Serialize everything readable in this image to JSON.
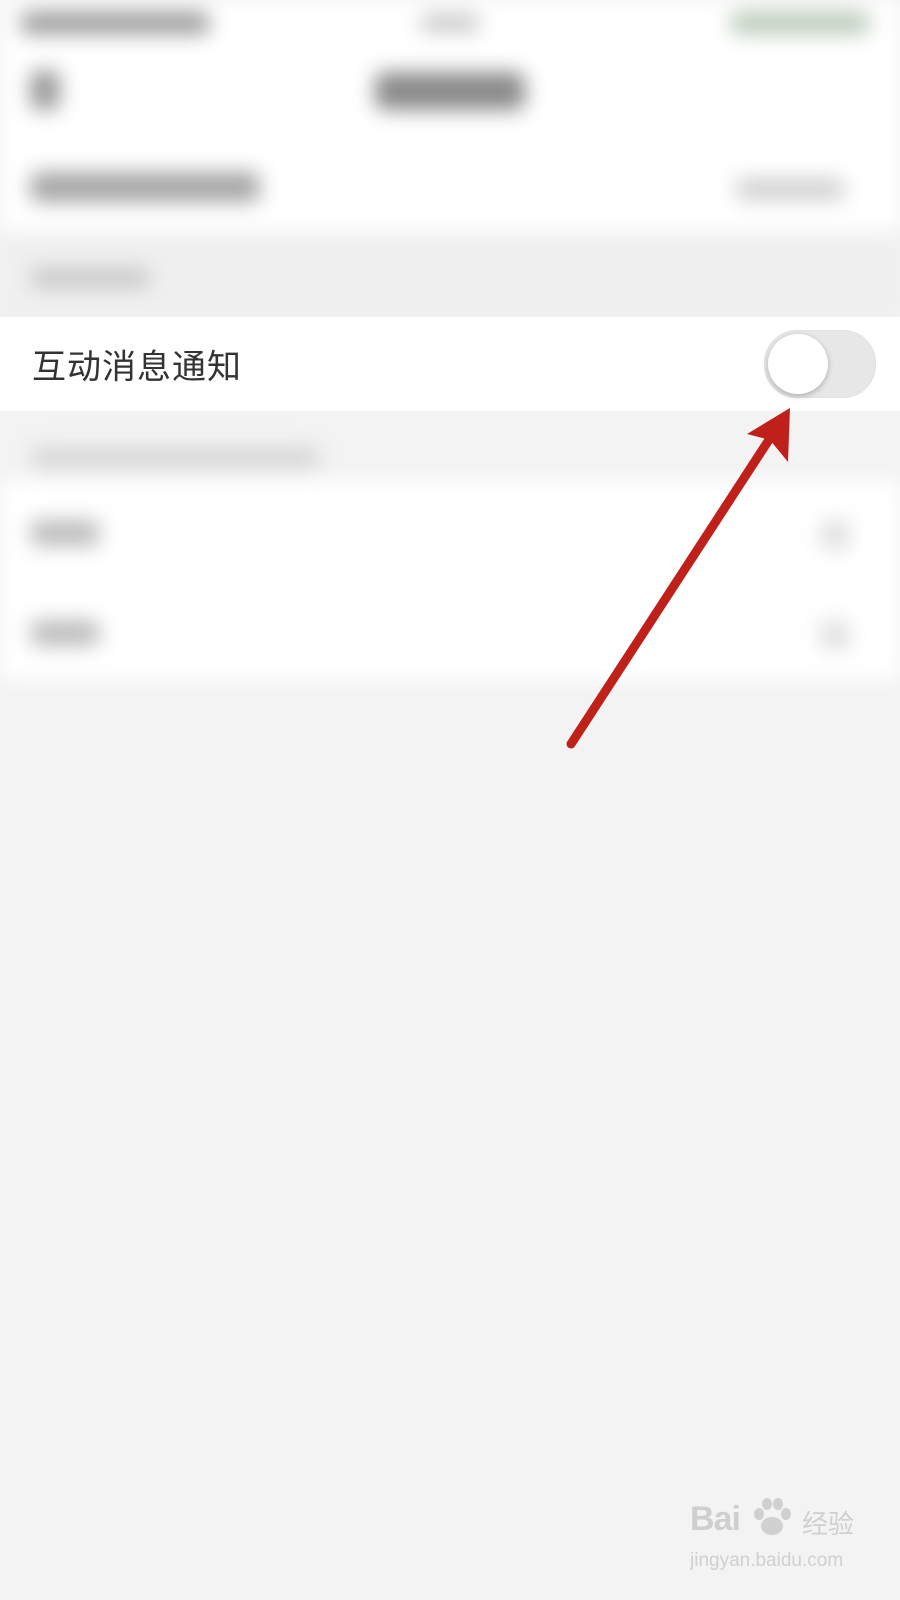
{
  "setting": {
    "label": "互动消息通知",
    "enabled": false
  },
  "colors": {
    "background": "#f3f3f3",
    "row_background": "#ffffff",
    "toggle_off": "#e7e7e7",
    "arrow": "#c0201a"
  },
  "icons": {
    "annotation": "red-arrow-annotation",
    "watermark_logo": "baidu-paw-logo"
  },
  "watermark": {
    "brand": "Bai",
    "brand_suffix": "经验",
    "domain": "jingyan.baidu.com"
  }
}
